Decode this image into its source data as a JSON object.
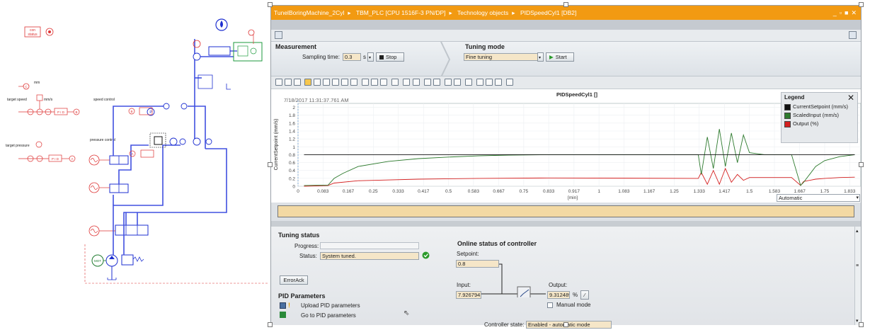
{
  "schematic": {
    "con_status": [
      "con",
      "status"
    ],
    "labels": {
      "mm": "mm",
      "mms": "mm/s",
      "target_speed": "target speed",
      "speed_control": "speed control",
      "target_pressure": "target pressure",
      "pressure_control": "pressure control",
      "pid1": "P I D",
      "pid2": "P I D",
      "b_node": "B",
      "c_node": "C",
      "a_node": "A",
      "p": "P",
      "a_pressure": "A",
      "mot": "MOT"
    }
  },
  "window": {
    "breadcrumb": [
      "TunelBoringMachine_2Cyl",
      "TBM_PLC [CPU 1516F-3 PN/DP]",
      "Technology objects",
      "PIDSpeedCyl1 [DB2]"
    ],
    "controls": [
      "_",
      "▫",
      "■",
      "✕"
    ]
  },
  "measurement": {
    "title": "Measurement",
    "sampling_label": "Sampling time:",
    "sampling_value": "0.3",
    "sampling_unit": "s",
    "stop_label": "Stop"
  },
  "tuning": {
    "title": "Tuning mode",
    "mode_value": "Fine tuning",
    "start_label": "Start"
  },
  "chart": {
    "timestamp": "7/18/2017 11:31:37.761 AM",
    "title": "PIDSpeedCyl1 []",
    "ylabel": "CurrentSetpoint (mm/s)",
    "xunit": "[min]",
    "mode_value": "Automatic",
    "legend_title": "Legend",
    "legend": [
      {
        "label": "CurrentSetpoint (mm/s)",
        "color": "#111111"
      },
      {
        "label": "ScaledInput (mm/s)",
        "color": "#2d7a2d"
      },
      {
        "label": "Output (%)",
        "color": "#d42020"
      }
    ]
  },
  "chart_data": {
    "type": "line",
    "yticks": [
      "2",
      "1.8",
      "1.6",
      "1.4",
      "1.2",
      "1",
      "0.8",
      "0.6",
      "0.4",
      "0.2",
      "0"
    ],
    "xticks": [
      "0",
      "0.083",
      "0.167",
      "0.25",
      "0.333",
      "0.417",
      "0.5",
      "0.583",
      "0.667",
      "0.75",
      "0.833",
      "0.917",
      "1",
      "1.083",
      "1.167",
      "1.25",
      "1.333",
      "1.417",
      "1.5",
      "1.583",
      "1.667",
      "1.75",
      "1.833"
    ],
    "ylim": [
      0,
      2.1
    ],
    "xlim": [
      0,
      1.87
    ],
    "series": [
      {
        "name": "CurrentSetpoint (mm/s)",
        "color": "#111111",
        "x": [
          0.02,
          0.1,
          0.1,
          1.33,
          1.33,
          1.85
        ],
        "y": [
          0.8,
          0.8,
          0.8,
          0.8,
          0.8,
          0.8
        ]
      },
      {
        "name": "ScaledInput (mm/s)",
        "color": "#2d7a2d",
        "x": [
          0.02,
          0.1,
          0.12,
          0.15,
          0.2,
          0.3,
          0.4,
          0.5,
          0.6,
          0.7,
          0.833,
          1.33,
          1.34,
          1.36,
          1.38,
          1.4,
          1.42,
          1.44,
          1.46,
          1.48,
          1.5,
          1.55,
          1.6,
          1.64,
          1.67,
          1.68,
          1.7,
          1.72,
          1.75,
          1.8,
          1.85
        ],
        "y": [
          0.02,
          0.03,
          0.2,
          0.33,
          0.5,
          0.63,
          0.7,
          0.74,
          0.77,
          0.79,
          0.8,
          0.8,
          0.3,
          1.25,
          0.45,
          1.45,
          0.5,
          1.35,
          0.6,
          1.3,
          0.85,
          0.8,
          0.8,
          0.8,
          0.02,
          0.1,
          0.3,
          0.5,
          0.65,
          0.75,
          0.8
        ]
      },
      {
        "name": "Output (%)",
        "color": "#d42020",
        "x": [
          0.02,
          0.1,
          0.12,
          0.2,
          0.4,
          0.6,
          0.833,
          1.33,
          1.34,
          1.36,
          1.38,
          1.4,
          1.42,
          1.44,
          1.46,
          1.48,
          1.5,
          1.6,
          1.64,
          1.67,
          1.68,
          1.72,
          1.75,
          1.8,
          1.85
        ],
        "y": [
          0.0,
          0.02,
          0.08,
          0.14,
          0.18,
          0.2,
          0.21,
          0.2,
          0.35,
          0.05,
          0.4,
          0.05,
          0.45,
          0.1,
          0.3,
          0.15,
          0.22,
          0.22,
          0.22,
          0.02,
          0.12,
          0.18,
          0.2,
          0.22,
          0.23
        ]
      }
    ]
  },
  "tuning_status": {
    "title": "Tuning status",
    "progress_label": "Progress:",
    "progress_fraction": 0,
    "status_label": "Status:",
    "status_value": "System tuned.",
    "erroack_label": "ErrorAck"
  },
  "pid_params": {
    "title": "PID Parameters",
    "upload_label": "Upload PID parameters",
    "goto_label": "Go to PID parameters"
  },
  "online": {
    "title": "Online status of controller",
    "setpoint_label": "Setpoint:",
    "setpoint_value": "0.8",
    "input_label": "Input:",
    "input_value": "7.926794",
    "output_label": "Output:",
    "output_value": "9.312489",
    "output_unit": "%",
    "manual_label": "Manual mode",
    "state_label": "Controller state:",
    "state_value": "Enabled - automatic mode"
  }
}
